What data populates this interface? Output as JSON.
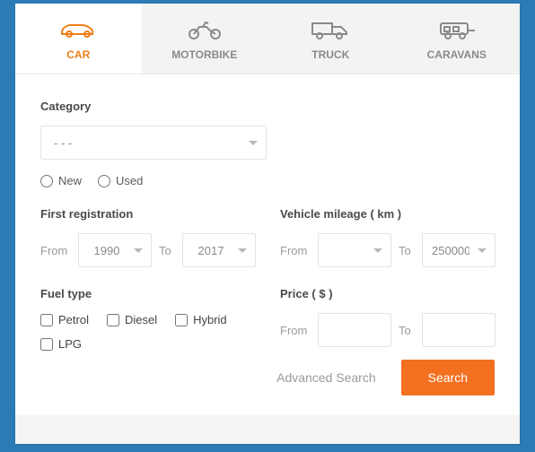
{
  "tabs": [
    {
      "label": "CAR"
    },
    {
      "label": "MOTORBIKE"
    },
    {
      "label": "TRUCK"
    },
    {
      "label": "CARAVANS"
    }
  ],
  "category": {
    "label": "Category",
    "value": "- - -"
  },
  "condition": {
    "new": "New",
    "used": "Used"
  },
  "registration": {
    "label": "First registration",
    "from_label": "From",
    "to_label": "To",
    "from_value": "1990",
    "to_value": "2017"
  },
  "mileage": {
    "label": "Vehicle mileage ( km )",
    "from_label": "From",
    "to_label": "To",
    "from_value": "",
    "to_value": "250000"
  },
  "fuel": {
    "label": "Fuel type",
    "options": [
      "Petrol",
      "Diesel",
      "Hybrid",
      "LPG"
    ]
  },
  "price": {
    "label": "Price ( $ )",
    "from_label": "From",
    "to_label": "To"
  },
  "actions": {
    "advanced": "Advanced Search",
    "search": "Search"
  }
}
